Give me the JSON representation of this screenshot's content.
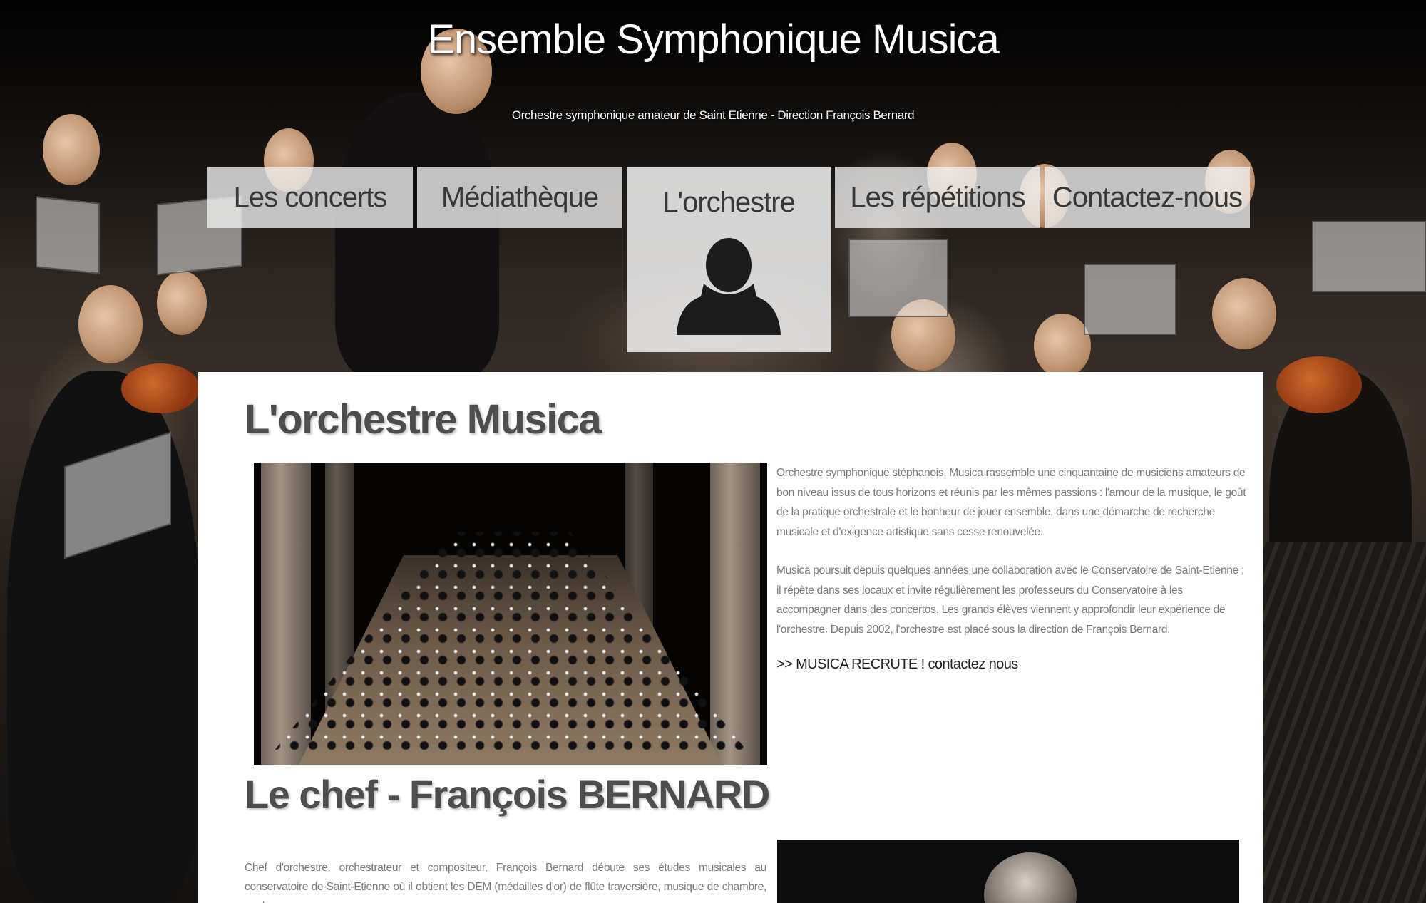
{
  "header": {
    "title": "Ensemble Symphonique Musica",
    "subtitle": "Orchestre symphonique amateur de Saint Etienne - Direction François Bernard"
  },
  "nav": {
    "items": [
      {
        "label": "Les concerts"
      },
      {
        "label": "Médiathèque"
      },
      {
        "label": "L'orchestre",
        "active": true,
        "icon": "person-icon"
      },
      {
        "label": "Les répétitions"
      },
      {
        "label": "Contactez-nous"
      }
    ]
  },
  "main": {
    "heading": "L'orchestre Musica",
    "paragraphs": [
      "Orchestre symphonique stéphanois, Musica rassemble une cinquantaine de musiciens amateurs de bon niveau issus de tous horizons et réunis par les mêmes passions : l'amour de la musique, le goût de la pratique orchestrale et le bonheur de jouer ensemble, dans une démarche de recherche musicale et d'exigence artistique sans cesse renouvelée.",
      "Musica poursuit depuis quelques années une collaboration avec le Conservatoire de Saint-Etienne ; il répète dans ses locaux et invite régulièrement les professeurs du Conservatoire à les accompagner dans des concertos. Les grands élèves viennent y approfondir leur expérience de l'orchestre. Depuis 2002, l'orchestre est placé sous la direction de François Bernard."
    ],
    "recruit_link": ">> MUSICA RECRUTE ! contactez nous",
    "chef_heading": "Le chef - François BERNARD",
    "chef_bio": "Chef d'orchestre, orchestrateur et compositeur, François Bernard débute ses études musicales au conservatoire de Saint-Etienne où il obtient les DEM (médailles d'or) de flûte traversière, musique de chambre, analyse,"
  },
  "colors": {
    "nav_bg": "#eeeeee",
    "heading_text": "#4d4d4d",
    "body_text": "#7a7a7a",
    "content_bg": "#ffffff"
  }
}
